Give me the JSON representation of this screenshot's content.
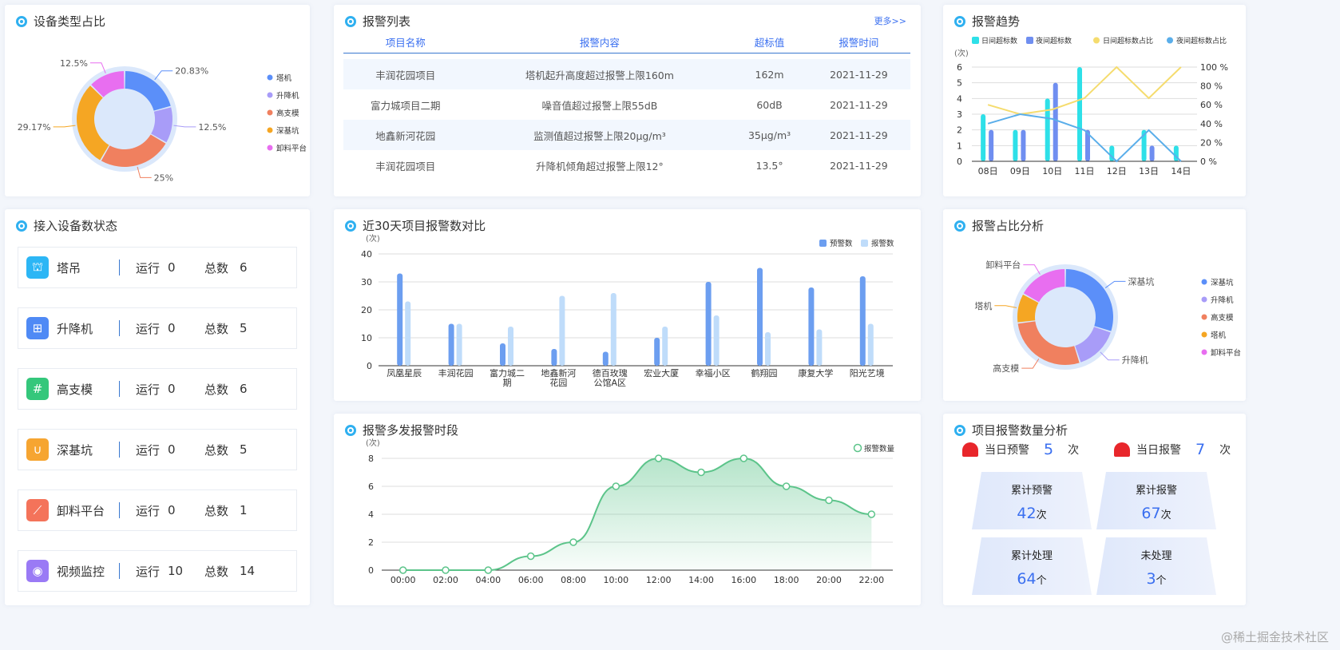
{
  "device_type": {
    "title": "设备类型占比",
    "chart_data": {
      "type": "pie",
      "labels": [
        "塔机",
        "升降机",
        "高支模",
        "深基坑",
        "卸料平台"
      ],
      "values": [
        20.83,
        12.5,
        25,
        29.17,
        12.5
      ],
      "value_labels": [
        "20.83%",
        "12.5%",
        "25%",
        "29.17%",
        "12.5%"
      ],
      "colors": [
        "#5b8ff9",
        "#a89cf8",
        "#f0805f",
        "#f5a623",
        "#e86ef0"
      ]
    }
  },
  "alarm_list": {
    "title": "报警列表",
    "more": "更多>>",
    "headers": [
      "项目名称",
      "报警内容",
      "超标值",
      "报警时间"
    ],
    "rows": [
      [
        "丰润花园项目",
        "塔机起升高度超过报警上限160m",
        "162m",
        "2021-11-29"
      ],
      [
        "富力城项目二期",
        "噪音值超过报警上限55dB",
        "60dB",
        "2021-11-29"
      ],
      [
        "地鑫新河花园",
        "监测值超过报警上限20μg/m³",
        "35μg/m³",
        "2021-11-29"
      ],
      [
        "丰润花园项目",
        "升降机倾角超过报警上限12°",
        "13.5°",
        "2021-11-29"
      ]
    ]
  },
  "trend": {
    "title": "报警趋势",
    "chart_data": {
      "type": "bar",
      "categories": [
        "08日",
        "09日",
        "10日",
        "11日",
        "12日",
        "13日",
        "14日"
      ],
      "yunit": "(次)",
      "ylim": [
        0,
        6
      ],
      "y2lim": [
        0,
        100
      ],
      "yticks": [
        "0",
        "1",
        "2",
        "3",
        "4",
        "5",
        "6"
      ],
      "y2ticks": [
        "0 %",
        "20 %",
        "40 %",
        "60 %",
        "80 %",
        "100 %"
      ],
      "series": [
        {
          "name": "日间超标数",
          "type": "bar",
          "color": "#2ee0e8",
          "values": [
            3,
            2,
            4,
            6,
            1,
            2,
            1
          ]
        },
        {
          "name": "夜间超标数",
          "type": "bar",
          "color": "#6f8ef0",
          "values": [
            2,
            2,
            5,
            2,
            0,
            1,
            0
          ]
        },
        {
          "name": "日间超标数占比",
          "type": "line",
          "color": "#f5dc6e",
          "values": [
            60,
            50,
            55,
            67,
            100,
            67,
            100
          ]
        },
        {
          "name": "夜间超标数占比",
          "type": "line",
          "color": "#5aaeea",
          "values": [
            40,
            50,
            45,
            33,
            0,
            33,
            0
          ]
        }
      ]
    }
  },
  "devices": {
    "title": "接入设备数状态",
    "run_label": "运行",
    "total_label": "总数",
    "items": [
      {
        "name": "塔吊",
        "run": "0",
        "total": "6",
        "color": "#2cb6f5",
        "icon": "crane-icon",
        "glyph": "⛫"
      },
      {
        "name": "升降机",
        "run": "0",
        "total": "5",
        "color": "#4f8af5",
        "icon": "elevator-icon",
        "glyph": "⊞"
      },
      {
        "name": "高支模",
        "run": "0",
        "total": "6",
        "color": "#34c77b",
        "icon": "formwork-icon",
        "glyph": "#"
      },
      {
        "name": "深基坑",
        "run": "0",
        "total": "5",
        "color": "#f6a531",
        "icon": "pit-icon",
        "glyph": "∪"
      },
      {
        "name": "卸料平台",
        "run": "0",
        "total": "1",
        "color": "#f4735a",
        "icon": "platform-icon",
        "glyph": "⟋"
      },
      {
        "name": "视频监控",
        "run": "10",
        "total": "14",
        "color": "#9a7af5",
        "icon": "camera-icon",
        "glyph": "◉"
      }
    ]
  },
  "compare": {
    "title": "近30天项目报警数对比",
    "chart_data": {
      "type": "bar",
      "categories": [
        "凤凰星辰",
        "丰润花园",
        "富力城二期",
        "地鑫新河花园",
        "德百玫瑰公馆A区",
        "宏业大厦",
        "幸福小区",
        "鹤翔园",
        "康复大学",
        "阳光艺境"
      ],
      "yunit": "(次)",
      "ylim": [
        0,
        40
      ],
      "yticks": [
        "0",
        "10",
        "20",
        "30",
        "40"
      ],
      "series": [
        {
          "name": "预警数",
          "color": "#6c9ef0",
          "values": [
            33,
            15,
            8,
            6,
            5,
            10,
            30,
            35,
            28,
            32
          ]
        },
        {
          "name": "报警数",
          "color": "#bfdcfa",
          "values": [
            23,
            15,
            14,
            25,
            26,
            14,
            18,
            12,
            13,
            15
          ]
        }
      ]
    }
  },
  "period": {
    "title": "报警多发报警时段",
    "chart_data": {
      "type": "area",
      "x": [
        "00:00",
        "02:00",
        "04:00",
        "06:00",
        "08:00",
        "10:00",
        "12:00",
        "14:00",
        "16:00",
        "18:00",
        "20:00",
        "22:00"
      ],
      "series": [
        {
          "name": "报警数量",
          "color": "#5cc48a",
          "values": [
            0,
            0,
            0,
            1,
            2,
            6,
            8,
            7,
            8,
            6,
            5,
            4
          ]
        }
      ],
      "yunit": "(次)",
      "ylim": [
        0,
        8
      ],
      "yticks": [
        "0",
        "2",
        "4",
        "6",
        "8"
      ]
    }
  },
  "ratio": {
    "title": "报警占比分析",
    "chart_data": {
      "type": "pie",
      "labels": [
        "深基坑",
        "升降机",
        "高支模",
        "塔机",
        "卸料平台"
      ],
      "values": [
        30,
        15,
        28,
        10,
        17
      ],
      "colors": [
        "#5b8ff9",
        "#a89cf8",
        "#f0805f",
        "#f5a623",
        "#e86ef0"
      ]
    }
  },
  "analysis": {
    "title": "项目报警数量分析",
    "today_warn_label": "当日预警",
    "today_warn": "5",
    "today_alarm_label": "当日报警",
    "today_alarm": "7",
    "unit_times": "次",
    "unit_items": "个",
    "cards": [
      {
        "label": "累计预警",
        "value": "42",
        "unit": "次"
      },
      {
        "label": "累计报警",
        "value": "67",
        "unit": "次"
      },
      {
        "label": "累计处理",
        "value": "64",
        "unit": "个"
      },
      {
        "label": "未处理",
        "value": "3",
        "unit": "个"
      }
    ]
  },
  "watermark": "@稀土掘金技术社区"
}
